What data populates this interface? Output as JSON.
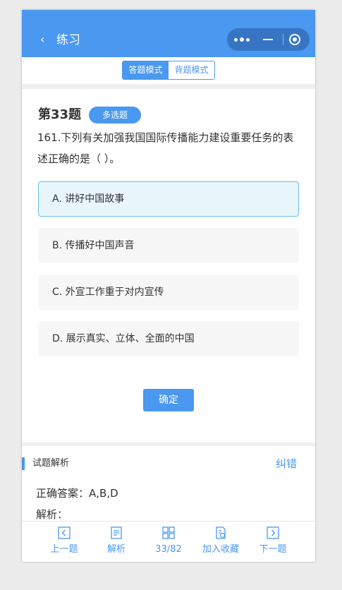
{
  "header": {
    "back_icon": "chevron-left-icon",
    "back_glyph": "‹",
    "title": "练习"
  },
  "modes": {
    "answer_mode": "答题模式",
    "recite_mode": "背题模式",
    "active": "answer_mode"
  },
  "question": {
    "number": "第33题",
    "type": "多选题",
    "text": "161.下列有关加强我国国际传播能力建设重要任务的表述正确的是（ ）。",
    "options": [
      {
        "label": "A. 讲好中国故事",
        "selected": true
      },
      {
        "label": "B. 传播好中国声音",
        "selected": false
      },
      {
        "label": "C. 外宣工作重于对内宣传",
        "selected": false
      },
      {
        "label": "D. 展示真实、立体、全面的中国",
        "selected": false
      }
    ],
    "confirm_label": "确定"
  },
  "analysis": {
    "section_title": "试题解析",
    "correction_link": "纠错",
    "correct_answer": "正确答案：A,B,D",
    "analysis_label": "解析："
  },
  "bottom_nav": {
    "prev": "上一题",
    "analysis": "解析",
    "progress": "33/82",
    "favorite": "加入收藏",
    "next": "下一题"
  },
  "colors": {
    "primary": "#4a98ef",
    "selected_bg": "#e8f5fb",
    "selected_border": "#67c0e9"
  }
}
